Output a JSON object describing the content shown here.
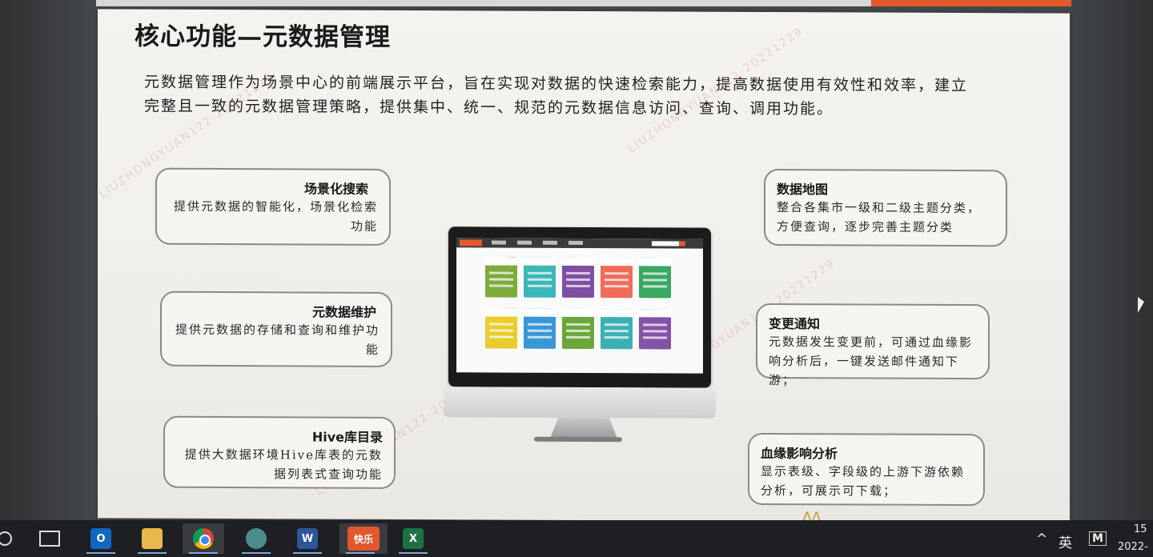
{
  "slide": {
    "title": "核心功能—元数据管理",
    "intro": "元数据管理作为场景中心的前端展示平台，旨在实现对数据的快速检索能力，提高数据使用有效性和效率，建立完整且一致的元数据管理策略，提供集中、统一、规范的元数据信息访问、查询、调用功能。",
    "left_cards": [
      {
        "title": "场景化搜索",
        "desc": "提供元数据的智能化，场景化检索功能"
      },
      {
        "title": "元数据维护",
        "desc": "提供元数据的存储和查询和维护功能"
      },
      {
        "title": "Hive库目录",
        "desc": "提供大数据环境Hive库表的元数据列表式查询功能"
      }
    ],
    "right_cards": [
      {
        "title": "数据地图",
        "desc": "整合各集市一级和二级主题分类， 方便查询，逐步完善主题分类"
      },
      {
        "title": "变更通知",
        "desc": "元数据发生变更前，可通过血缘影响分析后，一键发送邮件通知下游；"
      },
      {
        "title": "血缘影响分析",
        "desc": "显示表级、字段级的上游下游依赖分析，可展示可下载；"
      }
    ],
    "monitor_tiles_colors": [
      "#7cab3c",
      "#3cb6b8",
      "#7e4fa2",
      "#ef6b5a",
      "#3aa762",
      "#e9cc2e",
      "#3a97d6",
      "#6ca73b",
      "#3bb0b3",
      "#8452a6"
    ],
    "watermark": "LIUZHONGYUAN122-20221229"
  },
  "taskbar": {
    "apps": [
      {
        "name": "search",
        "label": ""
      },
      {
        "name": "task-view",
        "label": ""
      },
      {
        "name": "outlook",
        "label": "O"
      },
      {
        "name": "file-explorer",
        "label": ""
      },
      {
        "name": "chrome",
        "label": ""
      },
      {
        "name": "globe-app",
        "label": ""
      },
      {
        "name": "word",
        "label": "W"
      },
      {
        "name": "kuaile",
        "label": "快乐"
      },
      {
        "name": "excel",
        "label": "X"
      }
    ],
    "tray": {
      "chevron": "^",
      "ime": "英",
      "ime_mode": "M",
      "time": "15",
      "date": "2022-"
    }
  }
}
